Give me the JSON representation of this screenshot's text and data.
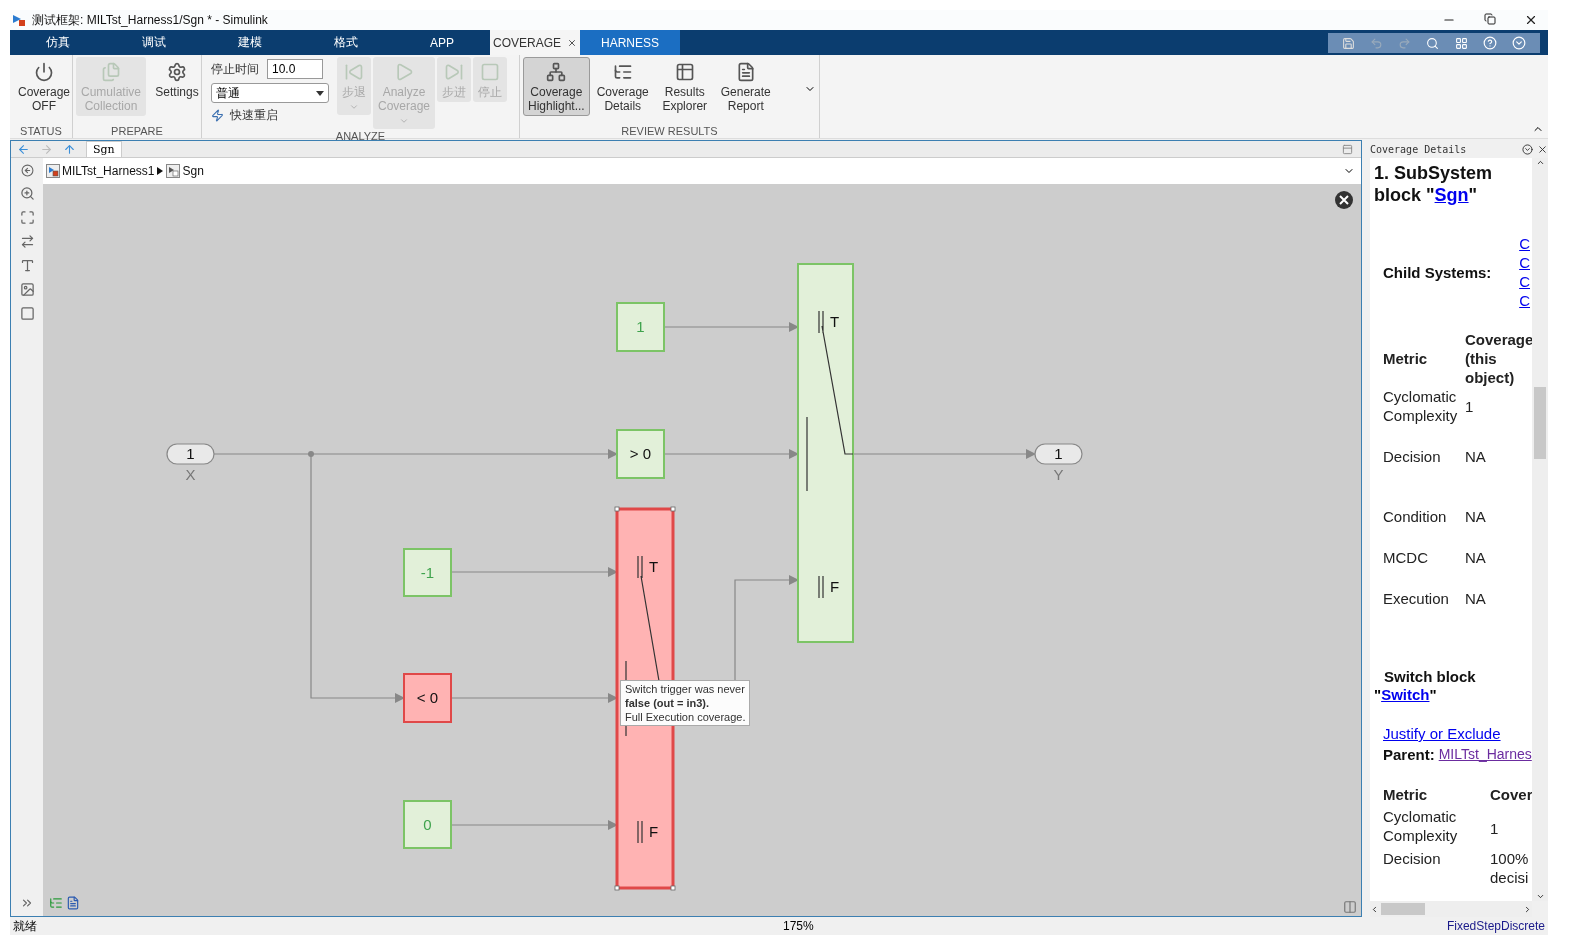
{
  "window": {
    "title": "测试框架: MILTst_Harness1/Sgn * - Simulink"
  },
  "tabs": [
    {
      "label": "仿真",
      "selected": false,
      "kind": "main",
      "closable": false
    },
    {
      "label": "调试",
      "selected": false,
      "kind": "main",
      "closable": false
    },
    {
      "label": "建模",
      "selected": false,
      "kind": "main",
      "closable": false
    },
    {
      "label": "格式",
      "selected": false,
      "kind": "main",
      "closable": false
    },
    {
      "label": "APP",
      "selected": false,
      "kind": "main",
      "closable": false
    },
    {
      "label": "COVERAGE",
      "selected": true,
      "kind": "contextual",
      "closable": true
    },
    {
      "label": "HARNESS",
      "selected": false,
      "kind": "contextual",
      "closable": false
    }
  ],
  "toolstrip": {
    "sections": [
      {
        "label": "STATUS",
        "items": [
          {
            "kind": "button",
            "lines": [
              "Coverage",
              "OFF"
            ],
            "disabled": false,
            "selected": false,
            "has_menu": false
          }
        ]
      },
      {
        "label": "PREPARE",
        "items": [
          {
            "kind": "button",
            "lines": [
              "Cumulative",
              "Collection"
            ],
            "disabled": true,
            "selected": false,
            "has_menu": false
          },
          {
            "kind": "button",
            "lines": [
              "Settings"
            ],
            "disabled": false,
            "selected": false,
            "has_menu": false
          }
        ]
      },
      {
        "label": "ANALYZE",
        "items": [
          {
            "kind": "stop_time",
            "label": "停止时间",
            "value": "10.0"
          },
          {
            "kind": "dropdown",
            "value": "普通"
          },
          {
            "kind": "toggle",
            "label": "快速重启"
          },
          {
            "kind": "button",
            "lines": [
              "步退"
            ],
            "disabled": true,
            "selected": false,
            "has_menu": true
          },
          {
            "kind": "button",
            "lines": [
              "Analyze",
              "Coverage"
            ],
            "disabled": true,
            "selected": false,
            "has_menu": true
          },
          {
            "kind": "button",
            "lines": [
              "步进"
            ],
            "disabled": true,
            "selected": false,
            "has_menu": false
          },
          {
            "kind": "button",
            "lines": [
              "停止"
            ],
            "disabled": true,
            "selected": false,
            "has_menu": false
          }
        ]
      },
      {
        "label": "REVIEW RESULTS",
        "items": [
          {
            "kind": "button",
            "lines": [
              "Coverage",
              "Highlight..."
            ],
            "disabled": false,
            "selected": true,
            "has_menu": false
          },
          {
            "kind": "button",
            "lines": [
              "Coverage",
              "Details"
            ],
            "disabled": false,
            "selected": false,
            "has_menu": false
          },
          {
            "kind": "button",
            "lines": [
              "Results",
              "Explorer"
            ],
            "disabled": false,
            "selected": false,
            "has_menu": false
          },
          {
            "kind": "button",
            "lines": [
              "Generate",
              "Report"
            ],
            "disabled": false,
            "selected": false,
            "has_menu": false
          }
        ]
      }
    ]
  },
  "editor": {
    "tab": "Sgn",
    "breadcrumb": [
      "MILTst_Harness1",
      "Sgn"
    ]
  },
  "diagram": {
    "blocks": [
      {
        "kind": "inport",
        "label": "1",
        "name": "X"
      },
      {
        "kind": "constant",
        "label": "1",
        "covered": true
      },
      {
        "kind": "compare",
        "label": "> 0",
        "covered": true
      },
      {
        "kind": "constant",
        "label": "-1",
        "covered": true
      },
      {
        "kind": "compare",
        "label": "< 0",
        "covered": false
      },
      {
        "kind": "constant",
        "label": "0",
        "covered": true
      },
      {
        "kind": "switch",
        "covered": false,
        "selected": true,
        "ports": [
          "T",
          "F"
        ]
      },
      {
        "kind": "switch",
        "covered": true,
        "selected": false,
        "ports": [
          "T",
          "F"
        ]
      },
      {
        "kind": "outport",
        "label": "1",
        "name": "Y"
      }
    ],
    "tooltip": [
      "Switch trigger was never",
      "**false (out = in3).**",
      "Full Execution coverage."
    ]
  },
  "coverage_panel": {
    "title": "Coverage Details",
    "heading": "1. SubSystem block \"",
    "heading_link": "Sgn",
    "heading_end": "\"",
    "child_systems": {
      "label": "Child Systems:",
      "links": [
        "C",
        "C",
        "C",
        "C"
      ]
    },
    "table": {
      "columns": [
        "Metric",
        "Coverage (this object)"
      ],
      "rows": [
        [
          "Cyclomatic Complexity",
          "1"
        ],
        [
          "Decision",
          "NA"
        ],
        [
          "Condition",
          "NA"
        ],
        [
          "MCDC",
          "NA"
        ],
        [
          "Execution",
          "NA"
        ]
      ]
    },
    "block": {
      "heading": "Switch block",
      "quote_open": "\"",
      "link": "Switch",
      "quote_close": "\"",
      "justify": "Justify or Exclude",
      "parent_label": "Parent:",
      "parent_link": "MILTst_Harnes"
    },
    "table2": {
      "columns": [
        "Metric",
        "Cover"
      ],
      "rows": [
        [
          "Cyclomatic Complexity",
          "1"
        ],
        [
          "Decision",
          "100% decisi"
        ]
      ]
    }
  },
  "status_bar": {
    "state": "就绪",
    "zoom": "175%",
    "solver": "FixedStepDiscrete"
  }
}
